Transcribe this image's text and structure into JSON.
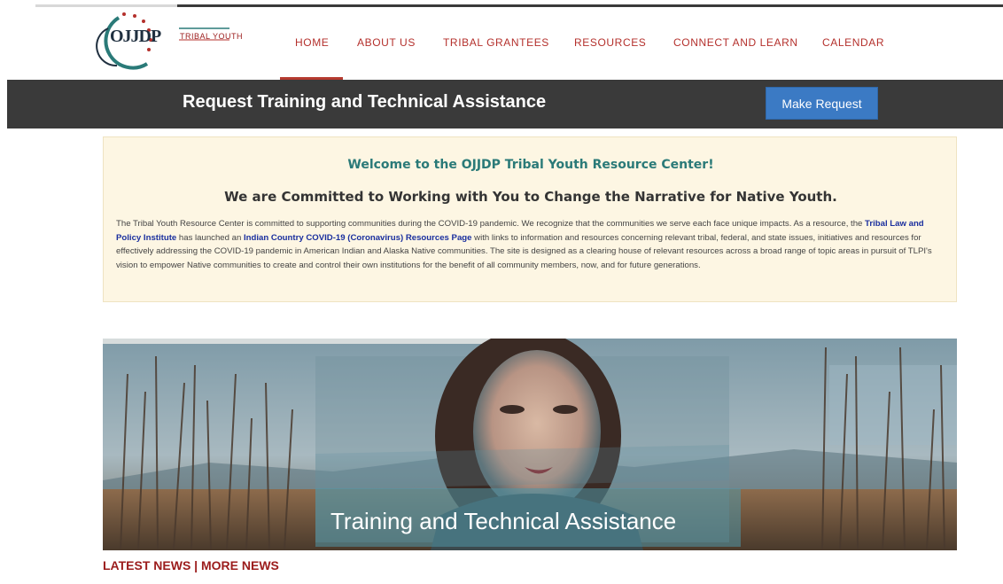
{
  "logo": {
    "main_text": "OJJDP",
    "sub_text": "TRIBAL YOUTH"
  },
  "nav": {
    "items": [
      {
        "label": "HOME",
        "active": true
      },
      {
        "label": "ABOUT US"
      },
      {
        "label": "TRIBAL GRANTEES"
      },
      {
        "label": "RESOURCES"
      },
      {
        "label": "CONNECT AND LEARN"
      },
      {
        "label": "CALENDAR"
      }
    ]
  },
  "banner": {
    "title": "Request Training and Technical Assistance",
    "button_label": "Make Request"
  },
  "welcome": {
    "title": "Welcome to the OJJDP Tribal Youth Resource Center!",
    "subtitle": "We are Committed to Working with You to Change the Narrative for Native Youth.",
    "body_part1": "The Tribal Youth Resource Center is committed to supporting communities during the COVID-19 pandemic. We recognize that the communities we serve each face unique impacts. As a resource, the ",
    "link1": "Tribal Law and Policy Institute",
    "body_part2": " has launched an ",
    "link2": "Indian Country COVID-19 (Coronavirus) Resources Page",
    "body_part3": "  with links to information and resources concerning relevant tribal, federal, and state issues, initiatives and resources for effectively addressing the COVID-19 pandemic in American Indian and Alaska Native communities. The site is designed as a clearing house of relevant resources across a broad range of topic areas in pursuit of TLPI's vision to empower Native communities to create and control their own institutions for the benefit of all community members, now, and for future generations."
  },
  "hero": {
    "caption": "Training and Technical Assistance"
  },
  "news": {
    "latest_label": "LATEST NEWS",
    "separator": " | ",
    "more_label": "MORE NEWS"
  },
  "colors": {
    "nav_text": "#b4302c",
    "banner_bg": "#3a3a3a",
    "button_bg": "#3b7ac4",
    "welcome_bg": "#fdf6e3",
    "welcome_title": "#2a7a78",
    "link": "#1a2f9e",
    "news_text": "#9b1c1c"
  }
}
